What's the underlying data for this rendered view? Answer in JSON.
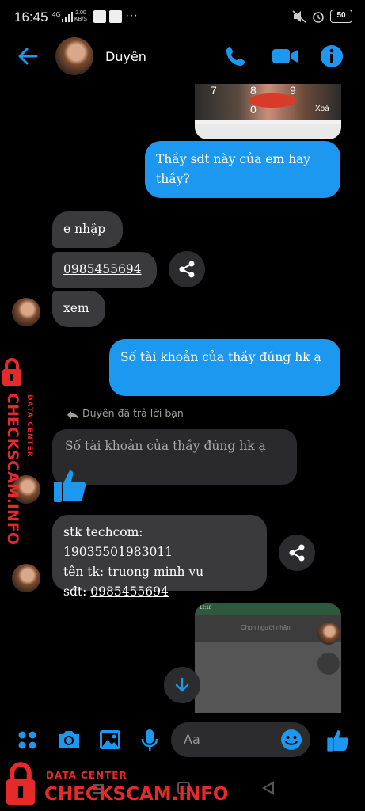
{
  "status_bar": {
    "time": "16:45",
    "network": "4G",
    "speed_top": "2.00",
    "speed_bottom": "KB/S",
    "battery": "50",
    "more": "···"
  },
  "header": {
    "contact_name": "Duyên",
    "icons": [
      "back-arrow-icon",
      "phone-icon",
      "video-camera-icon",
      "info-icon"
    ]
  },
  "shared_image_top": {
    "keys": [
      "7",
      "8",
      "9",
      "0"
    ],
    "delete_label": "Xoá"
  },
  "messages": [
    {
      "from": "me",
      "text": "Thầy sdt này của em hay thầy?"
    },
    {
      "from": "them",
      "text": "e nhập"
    },
    {
      "from": "them",
      "text": "0985455694",
      "is_link": true
    },
    {
      "from": "them",
      "text": "xem"
    },
    {
      "from": "me",
      "text": "Số tài khoản của thầy đúng hk ạ"
    },
    {
      "from": "them",
      "reply_label": "Duyên đã trả lời bạn",
      "quoted": "Số tài khoản của thầy đúng hk ạ",
      "reaction": "thumbs-up"
    },
    {
      "from": "them",
      "lines": [
        "stk techcom: 19035501983011",
        "tên tk: truong minh vu",
        "sđt: "
      ],
      "phone": "0985455694"
    }
  ],
  "shared_image_bottom": {
    "status_time": "12:18",
    "title": "Chọn người nhận"
  },
  "composer": {
    "placeholder": "Aa",
    "icons": [
      "menu-dots-icon",
      "camera-icon",
      "image-icon",
      "mic-icon",
      "emoji-icon",
      "thumbs-up-icon"
    ]
  },
  "watermark": {
    "small": "DATA CENTER",
    "big": "CHECKSCAM.INFO"
  },
  "colors": {
    "accent": "#1d98f0",
    "incoming_bubble": "#3a3a3c",
    "watermark": "#e52a2a"
  }
}
